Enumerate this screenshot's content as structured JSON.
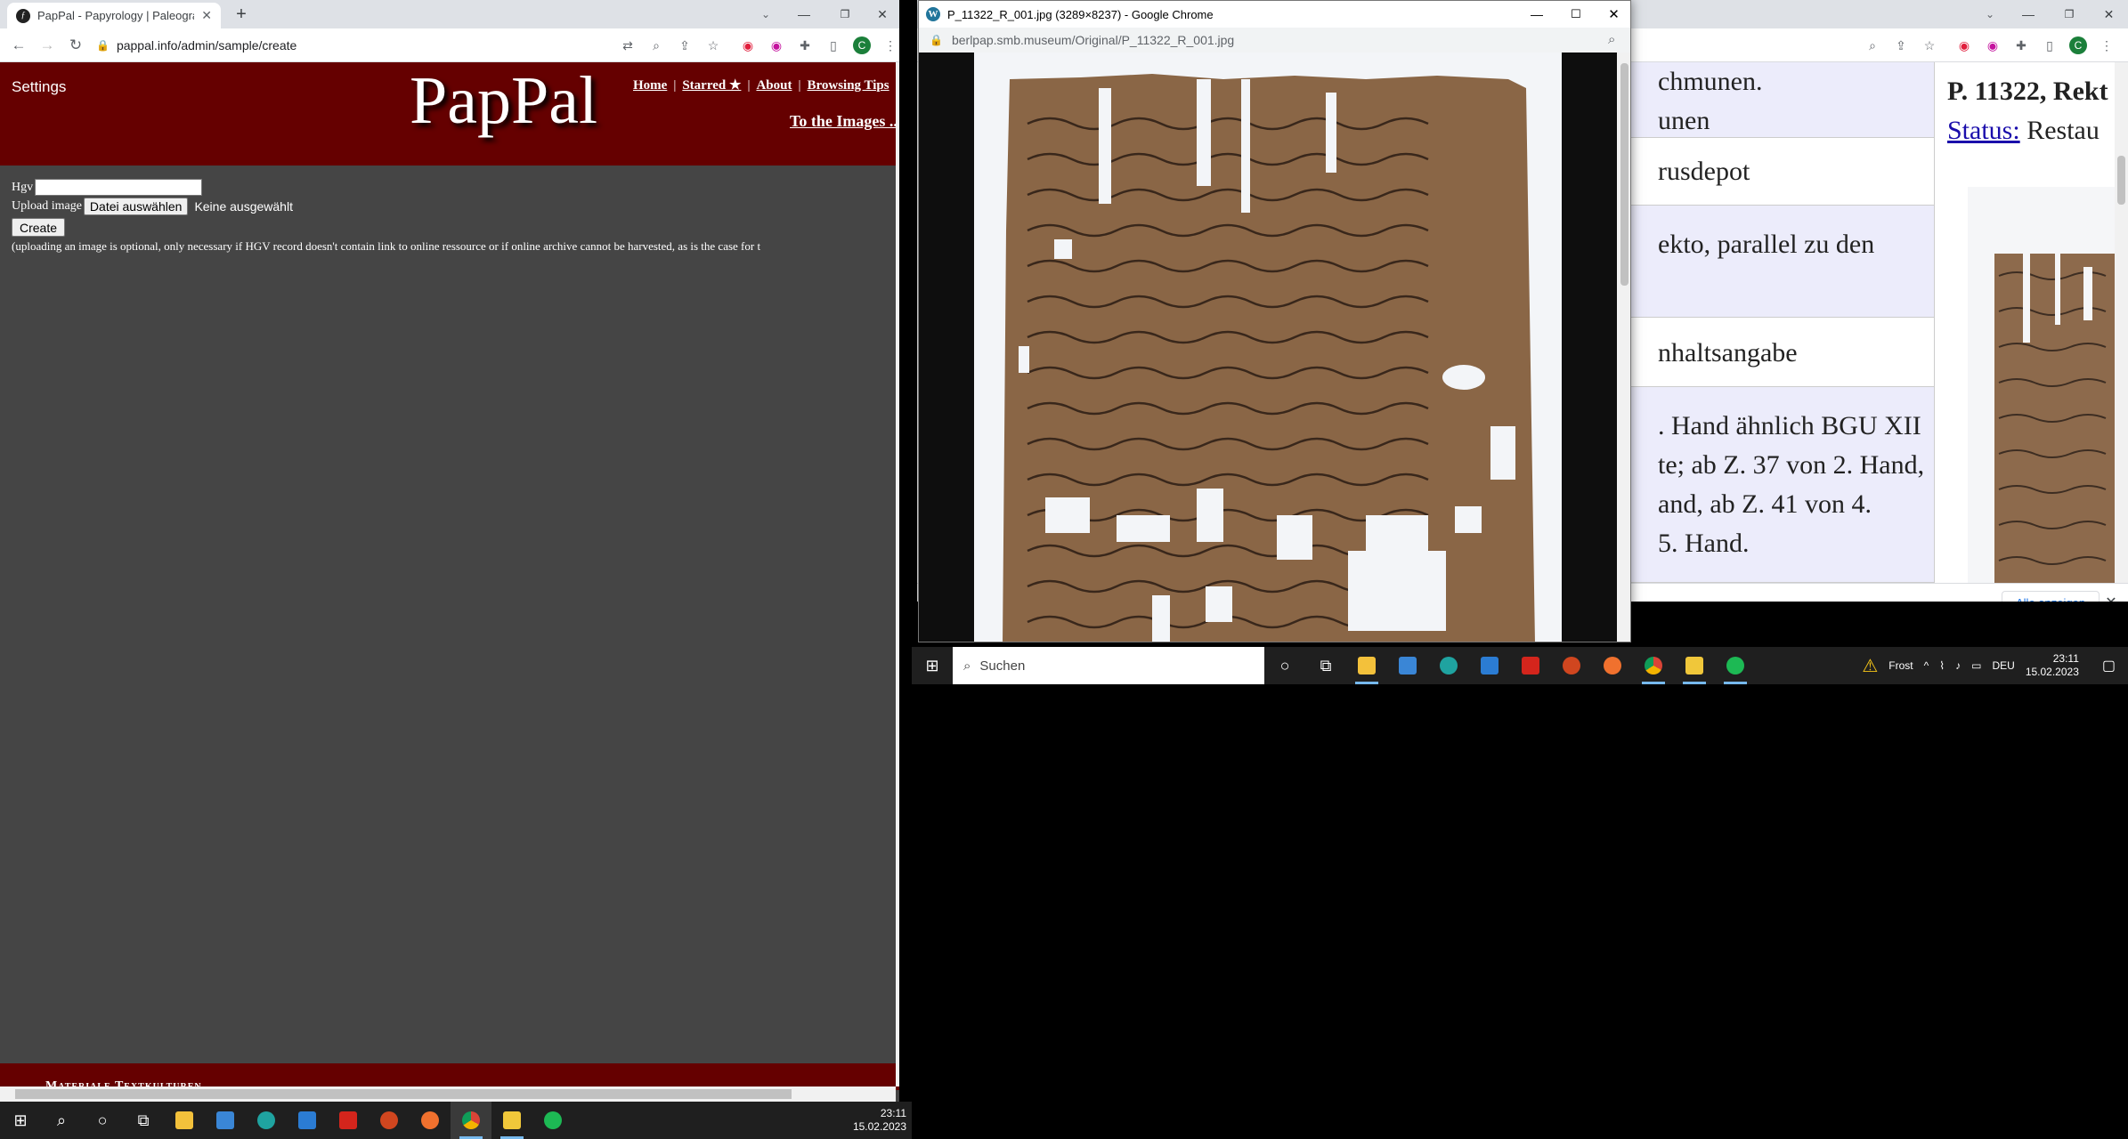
{
  "left_window": {
    "tab_title": "PapPal - Papyrology | Paleograph...",
    "favicon_letter": "ƒ",
    "url": "pappal.info/admin/sample/create",
    "profile_initial": "C",
    "header": {
      "settings": "Settings",
      "logo": "PapPal",
      "nav": [
        "Home",
        "Starred ★",
        "About",
        "Browsing Tips",
        "C"
      ],
      "images_link": "To the Images ..."
    },
    "form": {
      "hgv_label": "Hgv",
      "upload_label": "Upload image",
      "file_button": "Datei auswählen",
      "file_status": "Keine ausgewählt",
      "create_button": "Create",
      "note": "(uploading an image is optional, only necessary if HGV record doesn't contain link to online ressource or if online archive cannot be harvested, as is the case for t"
    },
    "footer_text": "Materiale Textkulturen"
  },
  "popup_window": {
    "title": "P_11322_R_001.jpg (3289×8237) - Google Chrome",
    "url": "berlpap.smb.museum/Original/P_11322_R_001.jpg"
  },
  "right_window": {
    "profile_initial": "C",
    "rows": [
      "chmunen.",
      "unen",
      "rusdepot",
      "ekto, parallel zu den",
      "nhaltsangabe",
      ". Hand ähnlich BGU XII",
      "te; ab Z. 37 von 2. Hand,",
      "and, ab Z. 41 von 4.",
      "5. Hand."
    ],
    "doc_title": "P. 11322, Rekt",
    "status_label": "Status:",
    "status_value": "Restau",
    "download_bar_button": "Alle anzeigen"
  },
  "taskbar_main": {
    "search_placeholder": "Suchen",
    "weather": "Frost",
    "lang": "DEU",
    "time": "23:11",
    "date": "15.02.2023"
  },
  "taskbar_left": {
    "time": "23:11",
    "date": "15.02.2023"
  }
}
